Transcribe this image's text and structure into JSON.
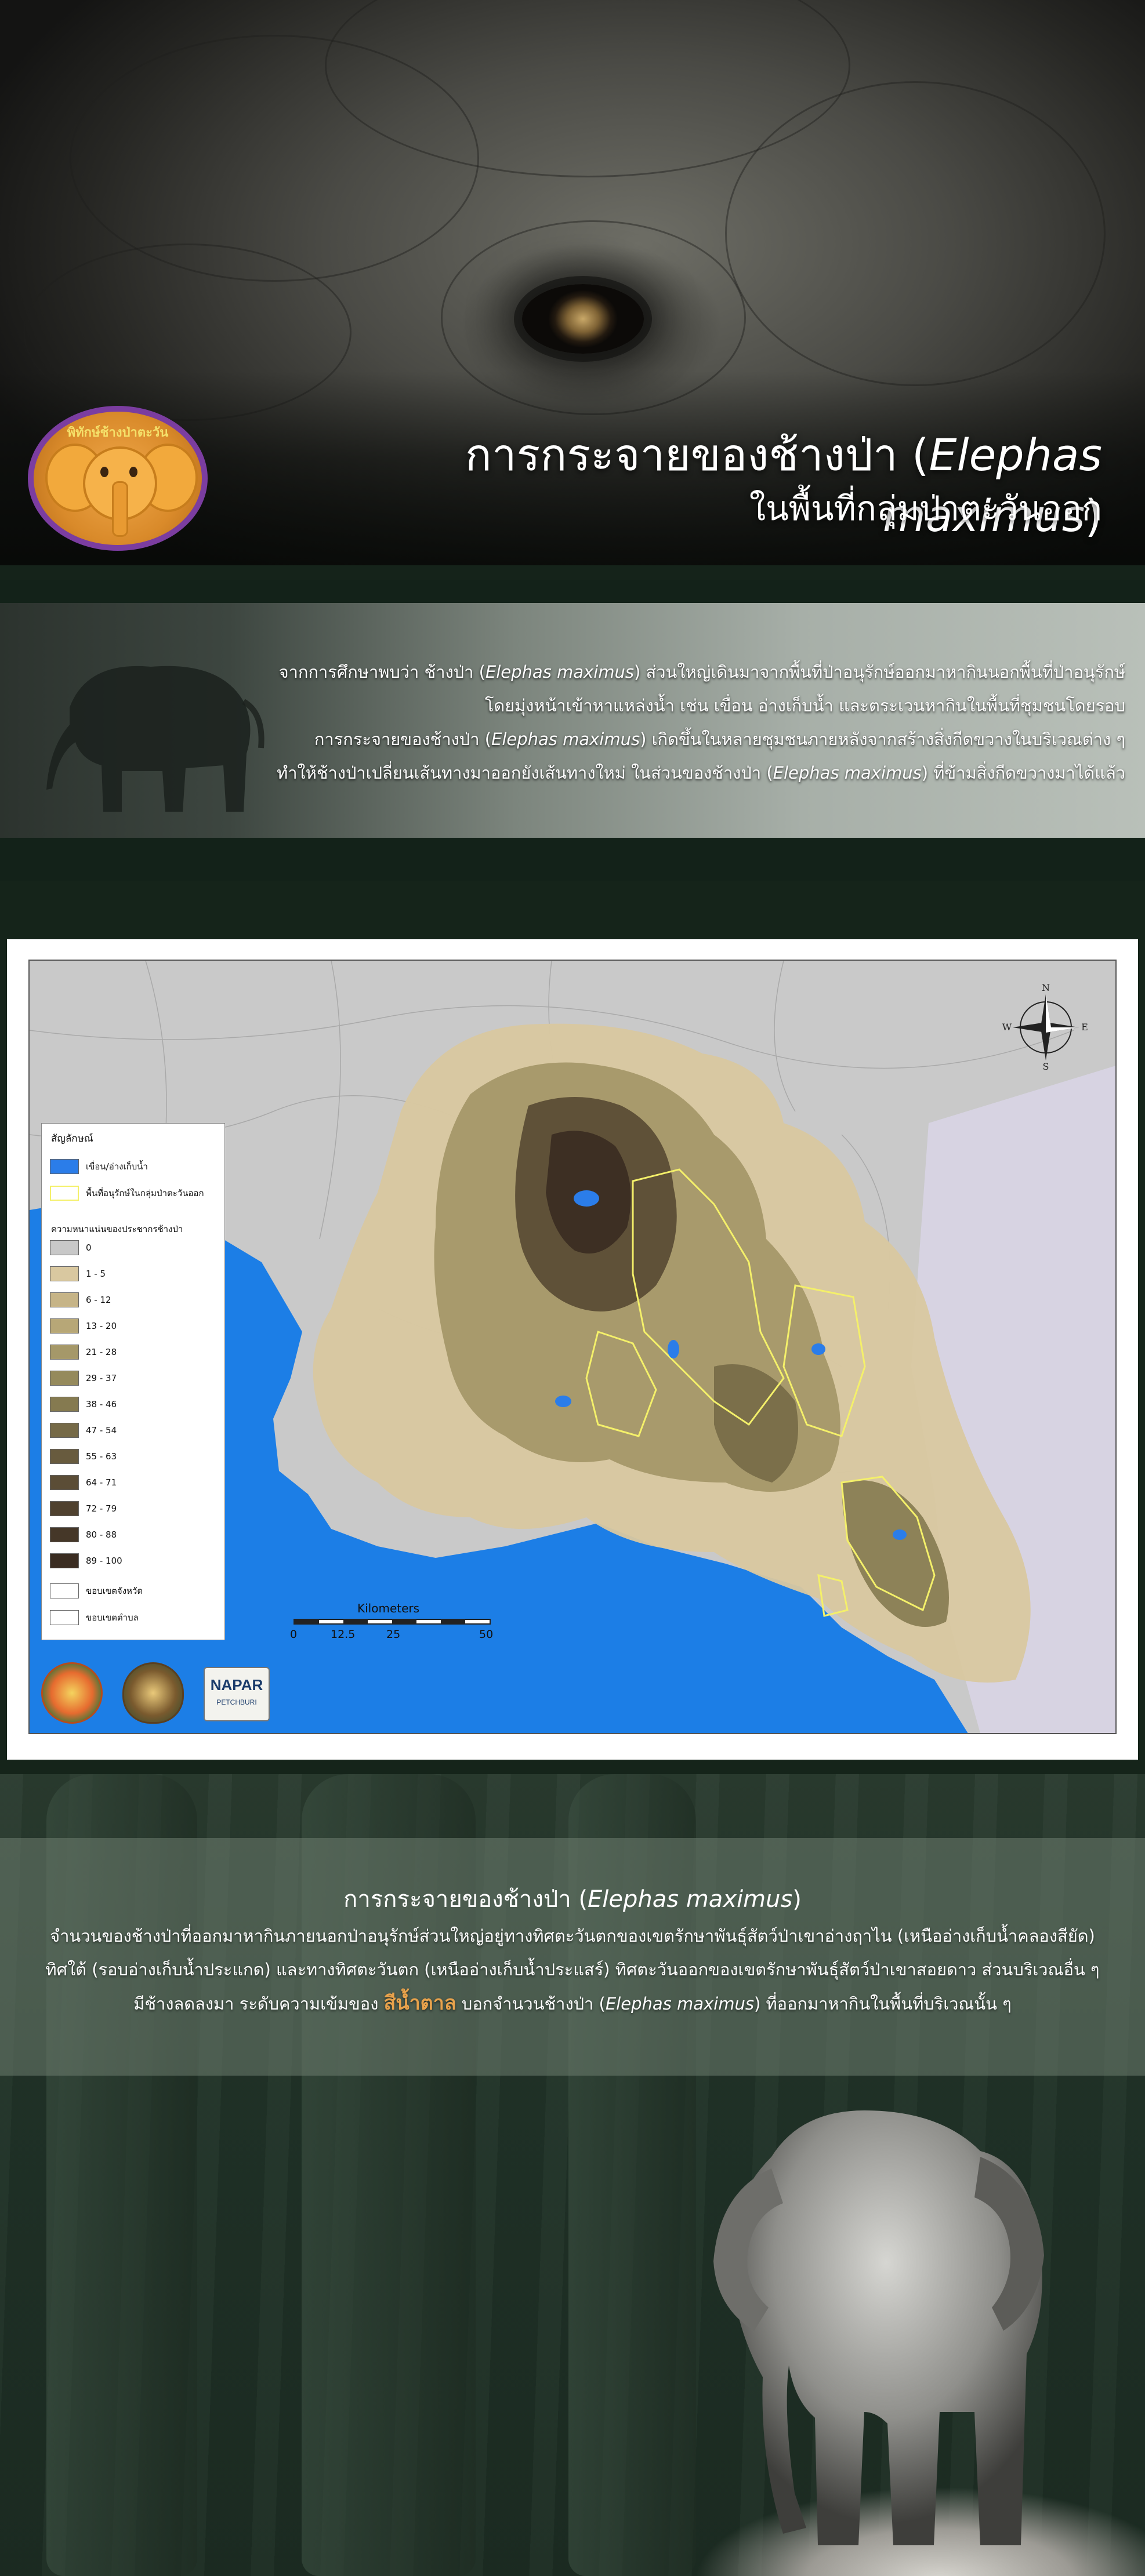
{
  "hero": {
    "title_prefix": "การกระจายของช้างป่า (",
    "title_sci": "Elephas maximus",
    "title_suffix": ")",
    "subtitle": "ในพื้นที่กลุ่มป่าตะวันออก",
    "logo_text": "พิทักษ์ช้างป่าตะวันออก"
  },
  "intro": {
    "lines": [
      [
        "จากการศึกษาพบว่า ช้างป่า (",
        "Elephas maximus",
        ") ส่วนใหญ่เดินมาจากพื้นที่ป่าอนุรักษ์ออกมาหากินนอกพื้นที่ป่าอนุรักษ์"
      ],
      [
        "โดยมุ่งหน้าเข้าหาแหล่งน้ำ เช่น เขื่อน อ่างเก็บน้ำ และตระเวนหากินในพื้นที่ชุมชนโดยรอบ",
        "",
        ""
      ],
      [
        "การกระจายของช้างป่า (",
        "Elephas maximus",
        ") เกิดขึ้นในหลายชุมชนภายหลังจากสร้างสิ่งกีดขวางในบริเวณต่าง ๆ"
      ],
      [
        "ทำให้ช้างป่าเปลี่ยนเส้นทางมาออกยังเส้นทางใหม่ ในส่วนของช้างป่า (",
        "Elephas maximus",
        ") ที่ข้ามสิ่งกีดขวางมาได้แล้ว"
      ]
    ]
  },
  "map": {
    "legend_title": "สัญลักษณ์",
    "reservoir_label": "เขื่อน/อ่างเก็บน้ำ",
    "protected_label": "พื้นที่อนุรักษ์ในกลุ่มป่าตะวันออก",
    "density_title": "ความหนาแน่นของประชากรช้างป่า",
    "density_classes": [
      {
        "label": "0",
        "color": "#c8c8c8"
      },
      {
        "label": "1 - 5",
        "color": "#d9c8a0"
      },
      {
        "label": "6 - 12",
        "color": "#c6b487"
      },
      {
        "label": "13 - 20",
        "color": "#b7a777"
      },
      {
        "label": "21 - 28",
        "color": "#a59869"
      },
      {
        "label": "29 - 37",
        "color": "#958a5c"
      },
      {
        "label": "38 - 46",
        "color": "#857a50"
      },
      {
        "label": "47 - 54",
        "color": "#766a47"
      },
      {
        "label": "55 - 63",
        "color": "#685b3e"
      },
      {
        "label": "64 - 71",
        "color": "#5b4d36"
      },
      {
        "label": "72 - 79",
        "color": "#4f412f"
      },
      {
        "label": "80 - 88",
        "color": "#453728"
      },
      {
        "label": "89 - 100",
        "color": "#3b2d22"
      }
    ],
    "province_label": "ขอบเขตจังหวัด",
    "subdistrict_label": "ขอบเขตตำบล",
    "scale_title": "Kilometers",
    "scale_ticks": [
      "0",
      "12.5",
      "25",
      "50"
    ],
    "compass": {
      "n": "N",
      "s": "S",
      "e": "E",
      "w": "W"
    },
    "org_napar": "NAPAR",
    "org_napar_sub": "PETCHBURI",
    "colors": {
      "sea": "#1c7ee6",
      "land": "#c9c9c9",
      "protected": "#f4f06a",
      "reservoir": "#2b7de9"
    }
  },
  "distribution": {
    "title_prefix": "การกระจายของช้างป่า (",
    "title_sci": "Elephas maximus",
    "title_suffix": ")",
    "line1": "จำนวนของช้างป่าที่ออกมาหากินภายนอกป่าอนุรักษ์ส่วนใหญ่อยู่ทางทิศตะวันตกของเขตรักษาพันธุ์สัตว์ป่าเขาอ่างฤาไน (เหนืออ่างเก็บน้ำคลองสียัด)",
    "line2": "ทิศใต้ (รอบอ่างเก็บน้ำประแกด) และทางทิศตะวันตก (เหนืออ่างเก็บน้ำประแสร์) ทิศตะวันออกของเขตรักษาพันธุ์สัตว์ป่าเขาสอยดาว ส่วนบริเวณอื่น ๆ",
    "line3_a": "มีช้างลดลงมา  ระดับความเข้มของ ",
    "line3_highlight": "สีน้ำตาล",
    "line3_b": " บอกจำนวนช้างป่า (",
    "line3_sci": "Elephas maximus",
    "line3_c": ") ที่ออกมาหากินในพื้นที่บริเวณนั้น ๆ",
    "highlight_color": "#e8a24c"
  }
}
